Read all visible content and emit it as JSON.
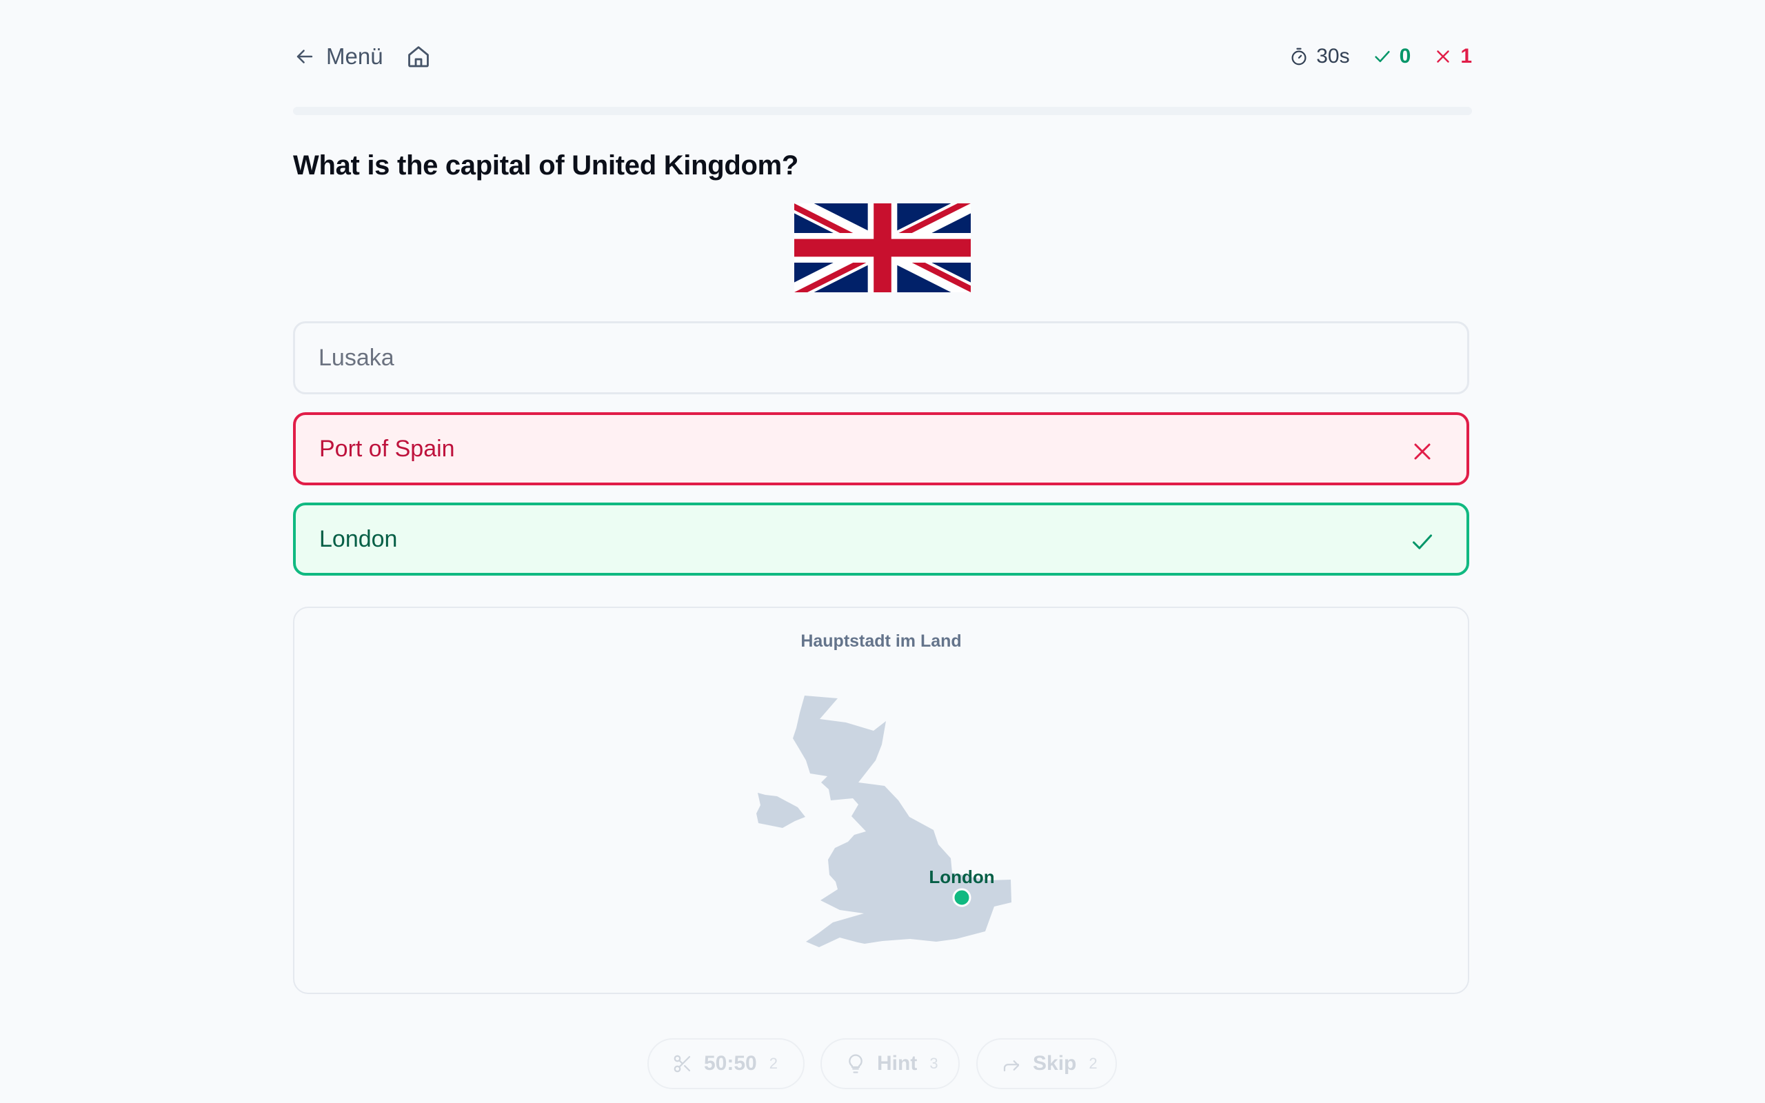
{
  "header": {
    "back_label": "Menü",
    "timer": "30s",
    "correct_count": "0",
    "wrong_count": "1"
  },
  "progress": 0,
  "question": "What is the capital of United Kingdom?",
  "answers": [
    {
      "label": "Lusaka",
      "state": "neutral"
    },
    {
      "label": "Port of Spain",
      "state": "wrong"
    },
    {
      "label": "London",
      "state": "correct"
    }
  ],
  "map": {
    "title": "Hauptstadt im Land",
    "city_label": "London"
  },
  "lifelines": [
    {
      "label": "50:50",
      "count": "2",
      "icon": "scissors-icon"
    },
    {
      "label": "Hint",
      "count": "3",
      "icon": "lightbulb-icon"
    },
    {
      "label": "Skip",
      "count": "2",
      "icon": "skip-arrow-icon"
    }
  ],
  "colors": {
    "correct": "#10b981",
    "wrong": "#e11d48",
    "land": "#cbd5e1",
    "flag_blue": "#012169",
    "flag_red": "#c8102e"
  }
}
